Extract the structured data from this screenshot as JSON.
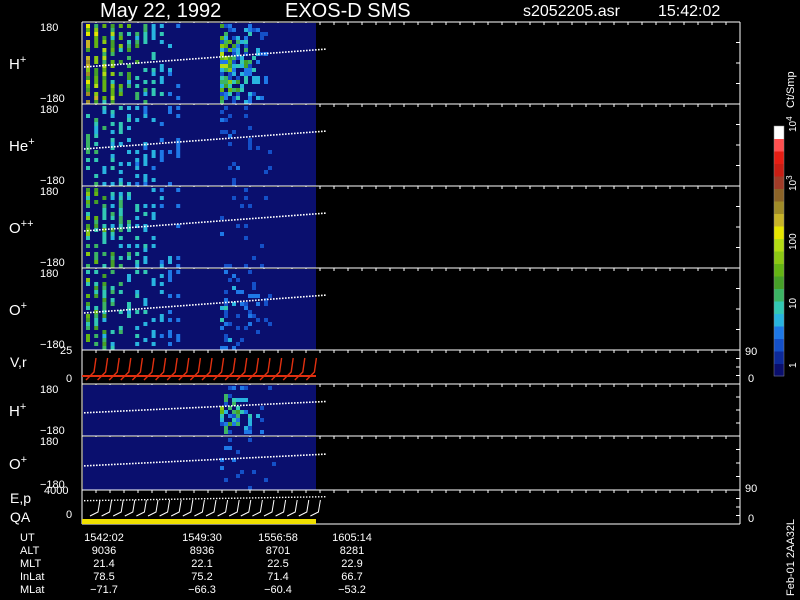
{
  "header": {
    "date": "May 22, 1992",
    "instrument": "EXOS-D SMS",
    "file": "s2052205.asr",
    "time": "15:42:02"
  },
  "footer_tag": "Feb-01 2AA32L",
  "colors": {
    "background": "#000000",
    "plot_bg": "#0a0f6e",
    "axis": "#ffffff",
    "accent_yellow": "#f0e000",
    "vr_red": "#e03010"
  },
  "colorbar": {
    "unit_label": "Ct/Smp",
    "labels": [
      {
        "text": "1",
        "value": 1
      },
      {
        "text": "10",
        "value": 10
      },
      {
        "text": "100",
        "value": 100
      },
      {
        "base": "10",
        "exp": "3",
        "value": 1000
      },
      {
        "base": "10",
        "exp": "4",
        "value": 10000
      }
    ],
    "colors": [
      "#0a0f6e",
      "#0d2a9a",
      "#1450c8",
      "#1e78e6",
      "#28b4e0",
      "#32c8b4",
      "#3cb464",
      "#46a028",
      "#64b414",
      "#8cc814",
      "#b4dc14",
      "#e6e600",
      "#c8b428",
      "#a08c28",
      "#8c6428",
      "#a03c28",
      "#c81e14",
      "#e61e14",
      "#ff5050",
      "#ffffff"
    ]
  },
  "ephemeris": {
    "labels": [
      "UT",
      "ALT",
      "MLT",
      "InLat",
      "MLat"
    ],
    "columns": [
      [
        "1542:02",
        "9036",
        "21.4",
        "78.5",
        "−71.7"
      ],
      [
        "1549:30",
        "8936",
        "22.1",
        "75.2",
        "−66.3"
      ],
      [
        "1556:58",
        "8701",
        "22.5",
        "71.4",
        "−60.4"
      ],
      [
        "1605:14",
        "8281",
        "22.9",
        "66.7",
        "−53.2"
      ]
    ]
  },
  "chart_data": [
    {
      "type": "heatmap",
      "panel": "H+ pitch angle",
      "species": "H",
      "charge": "+",
      "ylim_labels": [
        "180",
        "−180"
      ]
    },
    {
      "type": "heatmap",
      "panel": "He+ pitch angle",
      "species": "He",
      "charge": "+",
      "ylim_labels": [
        "180",
        "−180"
      ]
    },
    {
      "type": "heatmap",
      "panel": "O++ pitch angle",
      "species": "O",
      "charge": "++",
      "ylim_labels": [
        "180",
        "−180"
      ]
    },
    {
      "type": "heatmap",
      "panel": "O+ pitch angle",
      "species": "O",
      "charge": "+",
      "ylim_labels": [
        "180",
        "−180"
      ]
    },
    {
      "type": "line",
      "panel": "V,r",
      "label": "V,r",
      "left_ticks": [
        "25",
        "0"
      ],
      "right_ticks": [
        "90",
        "0"
      ]
    },
    {
      "type": "heatmap",
      "panel": "H+ (second)",
      "species": "H",
      "charge": "+",
      "ylim_labels": [
        "180",
        "−180"
      ]
    },
    {
      "type": "heatmap",
      "panel": "O+ (second)",
      "species": "O",
      "charge": "+",
      "ylim_labels": [
        "180",
        "−180"
      ]
    },
    {
      "type": "line",
      "panel": "E,p / QA",
      "labels": [
        "E,p",
        "QA"
      ],
      "left_ticks": [
        "4000",
        "0"
      ],
      "right_ticks": [
        "90",
        "0"
      ]
    }
  ]
}
